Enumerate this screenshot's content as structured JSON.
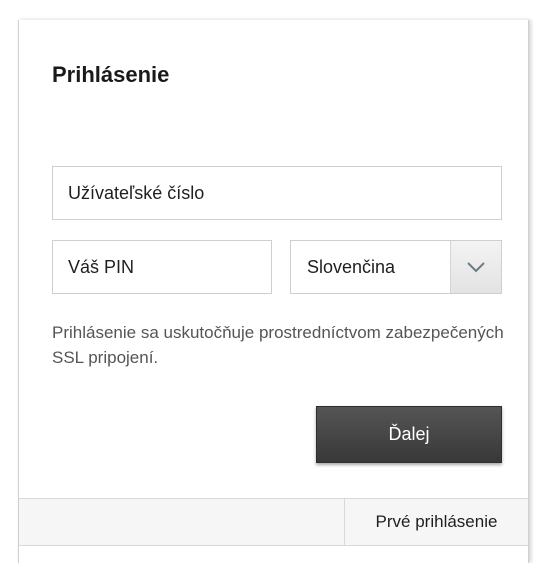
{
  "login": {
    "title": "Prihlásenie",
    "user_number_placeholder": "Užívateľské číslo",
    "pin_placeholder": "Váš PIN",
    "language_selected": "Slovenčina",
    "ssl_note": "Prihlásenie sa uskutočňuje prostredníctvom zabezpečených SSL pripojení.",
    "next_label": "Ďalej",
    "first_login_label": "Prvé prihlásenie"
  },
  "icons": {
    "language_dropdown": "chevron-down-icon"
  },
  "colors": {
    "button_background": "#444444",
    "footer_background": "#f6f6f6",
    "border": "#cfcfcf"
  }
}
